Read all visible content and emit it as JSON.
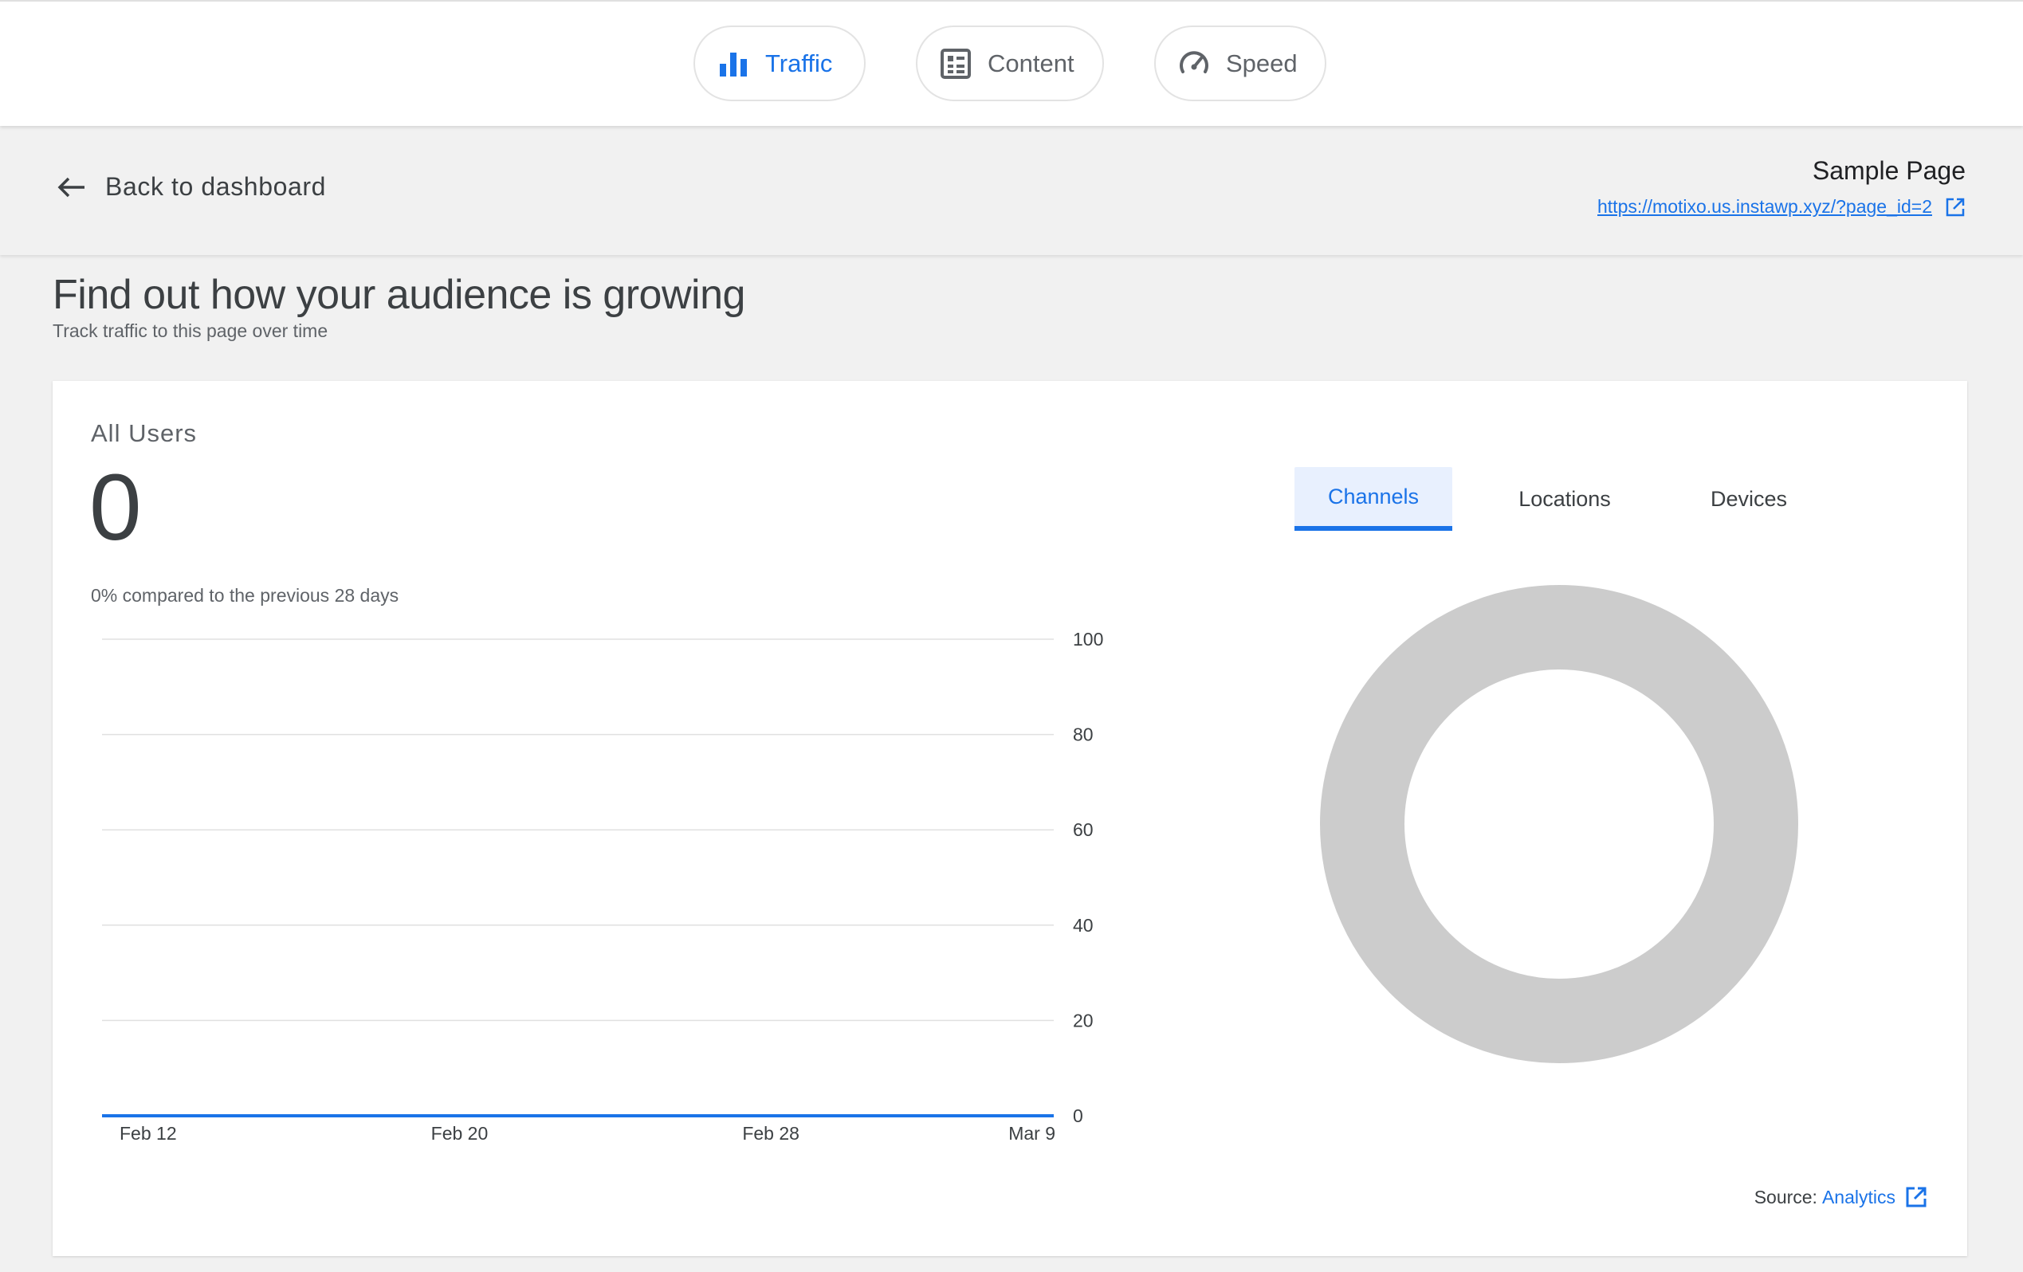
{
  "top_tabs": [
    {
      "label": "Traffic",
      "icon": "bar-chart-icon",
      "active": true
    },
    {
      "label": "Content",
      "icon": "content-list-icon",
      "active": false
    },
    {
      "label": "Speed",
      "icon": "speedometer-icon",
      "active": false
    }
  ],
  "header": {
    "back_label": "Back to dashboard",
    "page_title": "Sample Page",
    "page_url": "https://motixo.us.instawp.xyz/?page_id=2"
  },
  "main": {
    "heading": "Find out how your audience is growing",
    "subheading": "Track traffic to this page over time"
  },
  "card": {
    "label": "All Users",
    "total_value": "0",
    "change_percent": "0%",
    "compare_text": "compared to the previous 28 days",
    "dimension_tabs": [
      {
        "label": "Channels",
        "active": true
      },
      {
        "label": "Locations",
        "active": false
      },
      {
        "label": "Devices",
        "active": false
      }
    ],
    "source_prefix": "Source:",
    "source_link": "Analytics"
  },
  "colors": {
    "accent": "#1a73e8",
    "donut_empty": "#cccccc",
    "gridline": "#e0e0e0"
  },
  "chart_data": [
    {
      "type": "line",
      "x_ticks": [
        "Feb 12",
        "Feb 20",
        "Feb 28",
        "Mar 9"
      ],
      "y_ticks": [
        0,
        20,
        40,
        60,
        80,
        100
      ],
      "ylim": [
        0,
        100
      ],
      "series": [
        {
          "values": [
            0,
            0,
            0,
            0
          ]
        }
      ],
      "grid": true,
      "y_axis_side": "right"
    },
    {
      "type": "pie",
      "style": "donut",
      "values": []
    }
  ]
}
